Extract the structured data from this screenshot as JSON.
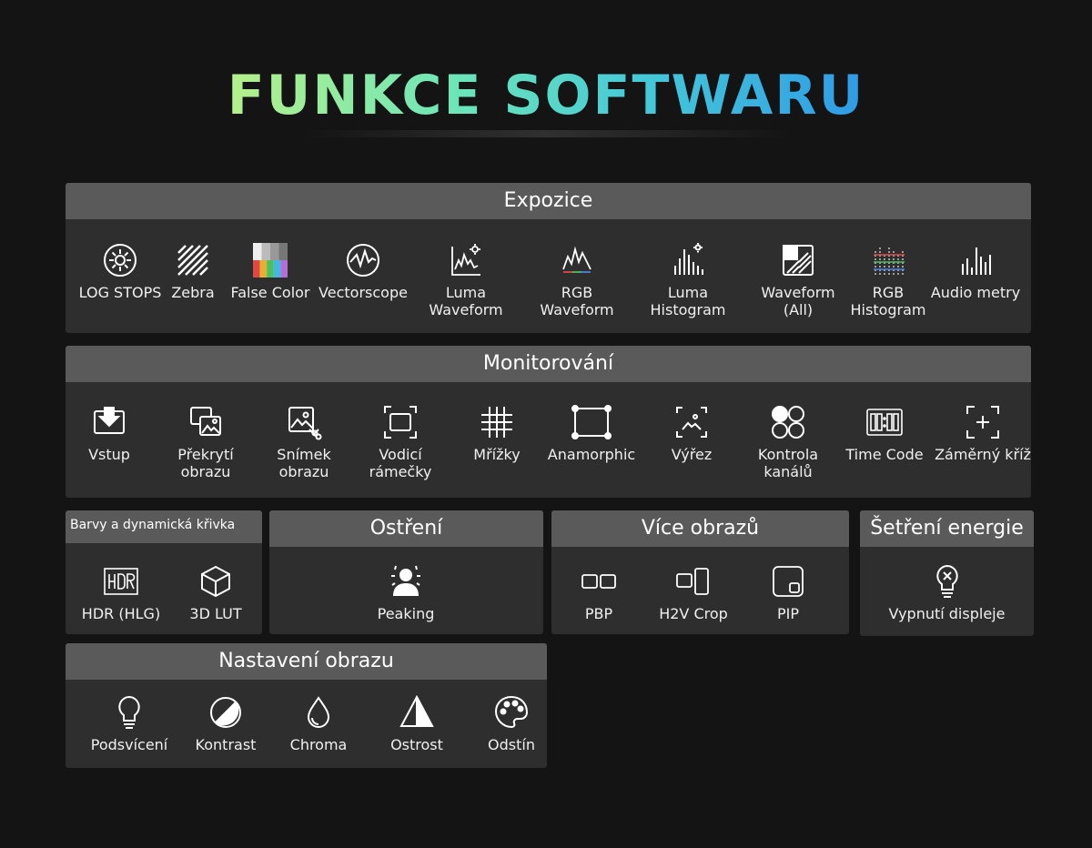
{
  "title": "FUNKCE SOFTWARU",
  "sections": {
    "expozice": {
      "header": "Expozice",
      "items": [
        {
          "label": "LOG STOPS",
          "icon": "sun-icon"
        },
        {
          "label": "Zebra",
          "icon": "zebra-icon"
        },
        {
          "label": "False Color",
          "icon": "false-color-icon"
        },
        {
          "label": "Vectorscope",
          "icon": "vectorscope-icon"
        },
        {
          "label": "Luma\nWaveform",
          "icon": "luma-waveform-icon"
        },
        {
          "label": "RGB\nWaveform",
          "icon": "rgb-waveform-icon"
        },
        {
          "label": "Luma\nHistogram",
          "icon": "luma-histogram-icon"
        },
        {
          "label": "Waveform\n(All)",
          "icon": "waveform-all-icon"
        },
        {
          "label": "RGB\nHistogram",
          "icon": "rgb-histogram-icon"
        },
        {
          "label": "Audio metry",
          "icon": "audio-meter-icon"
        }
      ]
    },
    "monitorovani": {
      "header": "Monitorování",
      "items": [
        {
          "label": "Vstup",
          "icon": "input-icon"
        },
        {
          "label": "Překrytí\nobrazu",
          "icon": "overlay-icon"
        },
        {
          "label": "Snímek\nobrazu",
          "icon": "snapshot-icon"
        },
        {
          "label": "Vodicí\nrámečky",
          "icon": "frame-guide-icon"
        },
        {
          "label": "Mřížky",
          "icon": "grid-icon"
        },
        {
          "label": "Anamorphic",
          "icon": "anamorphic-icon"
        },
        {
          "label": "Výřez",
          "icon": "crop-icon"
        },
        {
          "label": "Kontrola\nkanálů",
          "icon": "channel-check-icon"
        },
        {
          "label": "Time Code",
          "icon": "timecode-icon"
        },
        {
          "label": "Záměrný kříž",
          "icon": "crosshair-icon"
        }
      ]
    },
    "barvy": {
      "header": "Barvy a dynamická křivka",
      "items": [
        {
          "label": "HDR (HLG)",
          "icon": "hdr-icon"
        },
        {
          "label": "3D LUT",
          "icon": "lut-cube-icon"
        }
      ]
    },
    "ostreni": {
      "header": "Ostření",
      "items": [
        {
          "label": "Peaking",
          "icon": "peaking-icon"
        }
      ]
    },
    "vice_obrazu": {
      "header": "Více obrazů",
      "items": [
        {
          "label": "PBP",
          "icon": "pbp-icon"
        },
        {
          "label": "H2V Crop",
          "icon": "h2v-crop-icon"
        },
        {
          "label": "PIP",
          "icon": "pip-icon"
        }
      ]
    },
    "setreni": {
      "header": "Šetření energie",
      "items": [
        {
          "label": "Vypnutí displeje",
          "icon": "bulb-off-icon"
        }
      ]
    },
    "nastaveni": {
      "header": "Nastavení obrazu",
      "items": [
        {
          "label": "Podsvícení",
          "icon": "bulb-icon"
        },
        {
          "label": "Kontrast",
          "icon": "contrast-icon"
        },
        {
          "label": "Chroma",
          "icon": "drop-icon"
        },
        {
          "label": "Ostrost",
          "icon": "sharpness-icon"
        },
        {
          "label": "Odstín",
          "icon": "palette-icon"
        }
      ]
    }
  }
}
